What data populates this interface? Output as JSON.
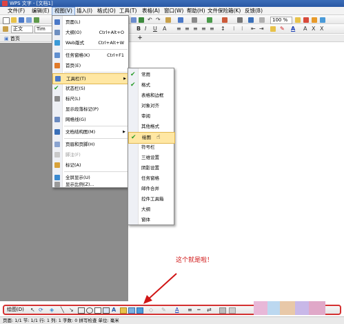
{
  "window": {
    "title": "WPS 文字 - [文档1]"
  },
  "menubar": {
    "items": [
      "文件(F)",
      "编辑(E)",
      "视图(V)",
      "插入(I)",
      "格式(O)",
      "工具(T)",
      "表格(A)",
      "窗口(W)",
      "帮助(H)",
      "文件保险箱(K)",
      "反馈(B)"
    ]
  },
  "toolbar": {
    "zoom": "100 %",
    "style_value": "正文",
    "font_value": "Tim",
    "format_glyphs": [
      "B",
      "I",
      "U",
      "A",
      "A",
      "A",
      "X",
      "X"
    ]
  },
  "tabs": {
    "doc_tab": "首页",
    "new_tab": "+"
  },
  "view_menu": {
    "items": [
      {
        "label": "页面(L)",
        "shortcut": "",
        "icon": "page-icon"
      },
      {
        "label": "大纲(O)",
        "shortcut": "Ctrl+Alt+O",
        "icon": "outline-icon"
      },
      {
        "label": "Web版式",
        "shortcut": "Ctrl+Alt+W",
        "icon": "web-icon"
      },
      {
        "label": "任务窗格(K)",
        "shortcut": "Ctrl+F1",
        "icon": "task-pane-icon"
      },
      {
        "label": "首页(E)",
        "shortcut": "",
        "icon": "home-icon"
      },
      {
        "label": "工具栏(T)",
        "shortcut": "",
        "icon": "toolbar-icon"
      },
      {
        "label": "状态栏(S)",
        "shortcut": "",
        "icon": "check-icon"
      },
      {
        "label": "标尺(L)",
        "shortcut": "",
        "icon": "ruler-icon"
      },
      {
        "label": "显示段落标记(P)",
        "shortcut": "",
        "icon": ""
      },
      {
        "label": "网格线(G)",
        "shortcut": "",
        "icon": "grid-icon"
      },
      {
        "label": "文档结构图(M)",
        "shortcut": "",
        "icon": "doc-map-icon"
      },
      {
        "label": "页眉和页脚(H)",
        "shortcut": "",
        "icon": "header-footer-icon"
      },
      {
        "label": "脚注(F)",
        "shortcut": "",
        "icon": "footnote-icon"
      },
      {
        "label": "标记(A)",
        "shortcut": "",
        "icon": "markup-icon"
      },
      {
        "label": "全屏显示(U)",
        "shortcut": "",
        "icon": "fullscreen-icon"
      },
      {
        "label": "显示比例(Z)...",
        "shortcut": "",
        "icon": "zoom-icon"
      }
    ]
  },
  "toolbar_submenu": {
    "items": [
      "常用",
      "格式",
      "表格和边框",
      "对象对齐",
      "审阅",
      "其他格式",
      "绘图",
      "符号栏",
      "三维设置",
      "阴影设置",
      "任务窗格",
      "邮件合并",
      "控件工具箱",
      "大纲",
      "窗体"
    ],
    "checked": [
      "常用",
      "格式",
      "绘图"
    ],
    "highlighted": "绘图"
  },
  "annotation": {
    "text": "这个就是啦！",
    "color": "#d01515"
  },
  "drawing_toolbar": {
    "label": "绘图(D)"
  },
  "statusbar": {
    "text": "页面: 1/1  节: 1/1  行: 1  列: 1  字数: 0  拼写检查  单位: 毫米"
  },
  "colors": {
    "highlight": "#ffe7a3",
    "check": "#2a9d2a",
    "frame": "#d43030"
  }
}
